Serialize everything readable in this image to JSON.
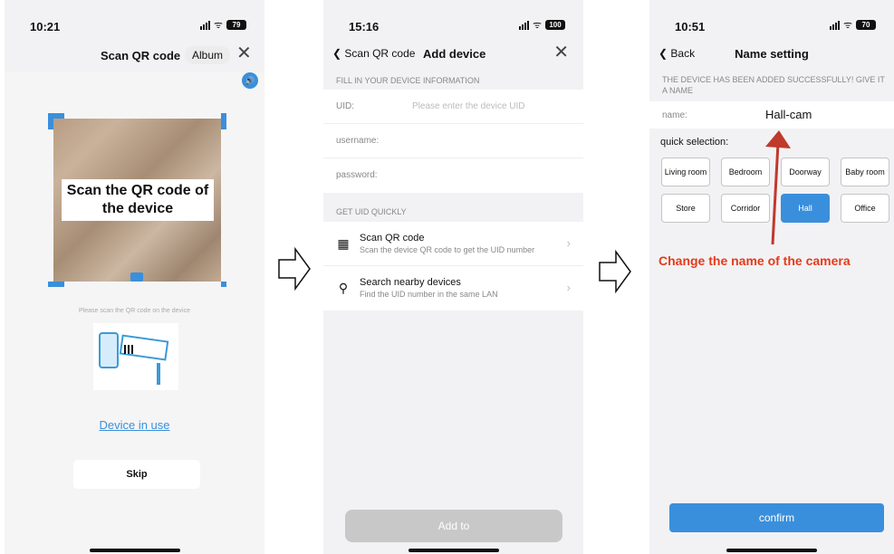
{
  "colors": {
    "accent": "#3a8fdc",
    "annotation": "#e53a1b"
  },
  "screen1": {
    "time": "10:21",
    "battery": "79",
    "title": "Scan QR code",
    "album_label": "Album",
    "close_icon": "✕",
    "speaker_icon": "🔊",
    "scan_overlay_text": "Scan the QR code of the device",
    "hint": "Please scan the QR code on the device",
    "device_in_use_link": "Device in use",
    "skip_label": "Skip"
  },
  "screen2": {
    "time": "15:16",
    "battery": "100",
    "back_label": "Scan QR code",
    "title": "Add device",
    "close_icon": "✕",
    "section1_header": "FILL IN YOUR DEVICE INFORMATION",
    "fields": [
      {
        "label": "UID:",
        "placeholder": "Please enter the device UID"
      },
      {
        "label": "username:",
        "placeholder": ""
      },
      {
        "label": "password:",
        "placeholder": ""
      }
    ],
    "section2_header": "GET UID QUICKLY",
    "quick": [
      {
        "icon": "qr-code-icon",
        "glyph": "▦",
        "title": "Scan QR code",
        "subtitle": "Scan the device QR code to get the UID number"
      },
      {
        "icon": "search-icon",
        "glyph": "⚲",
        "title": "Search nearby devices",
        "subtitle": "Find the UID number in the same LAN"
      }
    ],
    "add_label": "Add to"
  },
  "screen3": {
    "time": "10:51",
    "battery": "70",
    "back_label": "Back",
    "title": "Name setting",
    "success_message": "THE DEVICE HAS BEEN ADDED SUCCESSFULLY! GIVE IT A NAME",
    "name_label": "name:",
    "name_value": "Hall-cam",
    "quick_selection_label": "quick selection:",
    "options": [
      "Living room",
      "Bedroom",
      "Doorway",
      "Baby room",
      "Store",
      "Corridor",
      "Hall",
      "Office"
    ],
    "selected_option": "Hall",
    "annotation": "Change the name of the camera",
    "confirm_label": "confirm"
  }
}
